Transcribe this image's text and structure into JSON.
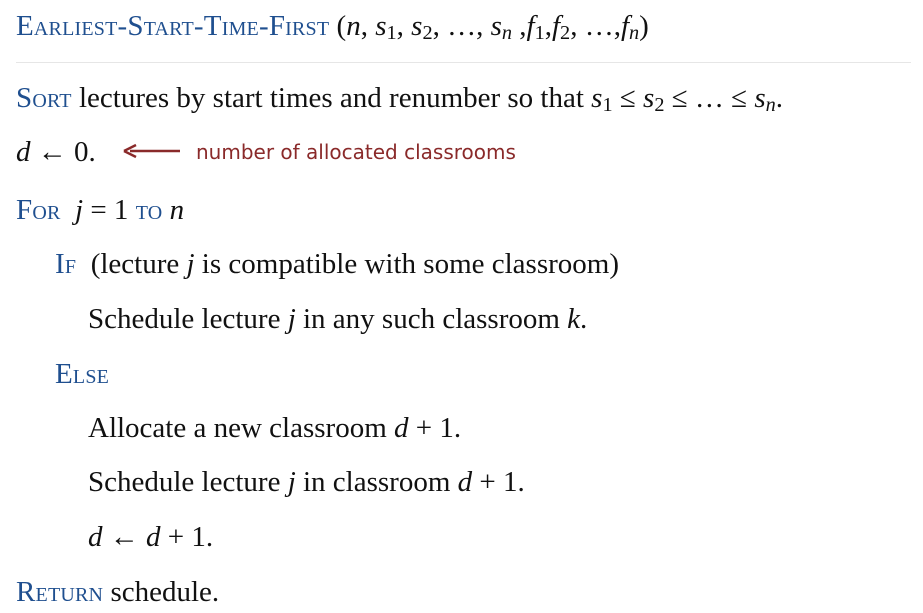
{
  "header": {
    "title": "Earliest-Start-Time-First",
    "params_open": "(",
    "n": "n",
    "c1": ", ",
    "s1": "s",
    "s1_sub": "1",
    "c2": ", ",
    "s2": "s",
    "s2_sub": "2",
    "c3": ", …, ",
    "sn": "s",
    "sn_sub": "n",
    "c4": " ,",
    "f1": "f",
    "f1_sub": "1",
    "c5": ",",
    "f2": "f",
    "f2_sub": "2",
    "c6": ", …,",
    "fn": "f",
    "fn_sub": "n",
    "params_close": ")"
  },
  "line_sort": {
    "kw": "Sort",
    "text": " lectures by start times and renumber so that ",
    "s1": "s",
    "s1_sub": "1",
    "le1": " ≤ ",
    "s2": "s",
    "s2_sub": "2",
    "le2": " ≤ … ≤ ",
    "sn": "s",
    "sn_sub": "n",
    "end": "."
  },
  "line_init": {
    "d": "d",
    "assign": " ← 0.",
    "comment": "number of allocated classrooms",
    "arrow_color": "#8a2a2a"
  },
  "line_for": {
    "kw_for": "For",
    "j": "j",
    "eq": " = 1 ",
    "kw_to": "to",
    "n": "n"
  },
  "line_if": {
    "kw": "If",
    "pre": "(lecture ",
    "j": "j",
    "post": " is compatible with some classroom)"
  },
  "line_schedule1": {
    "pre": "Schedule lecture ",
    "j": "j",
    "mid": " in any such classroom ",
    "k": "k",
    "end": "."
  },
  "line_else": {
    "kw": "Else"
  },
  "line_allocate": {
    "pre": "Allocate a new classroom ",
    "d": "d",
    "post": " + 1."
  },
  "line_schedule2": {
    "pre": "Schedule lecture ",
    "j": "j",
    "mid": " in classroom ",
    "d": "d",
    "post": " + 1."
  },
  "line_incr": {
    "d1": "d",
    "assign": " ← ",
    "d2": "d",
    "post": " + 1."
  },
  "line_return": {
    "kw": "Return",
    "text": " schedule."
  },
  "colors": {
    "keyword": "#1f4f8f",
    "comment": "#8a2a2a",
    "text": "#111111"
  }
}
